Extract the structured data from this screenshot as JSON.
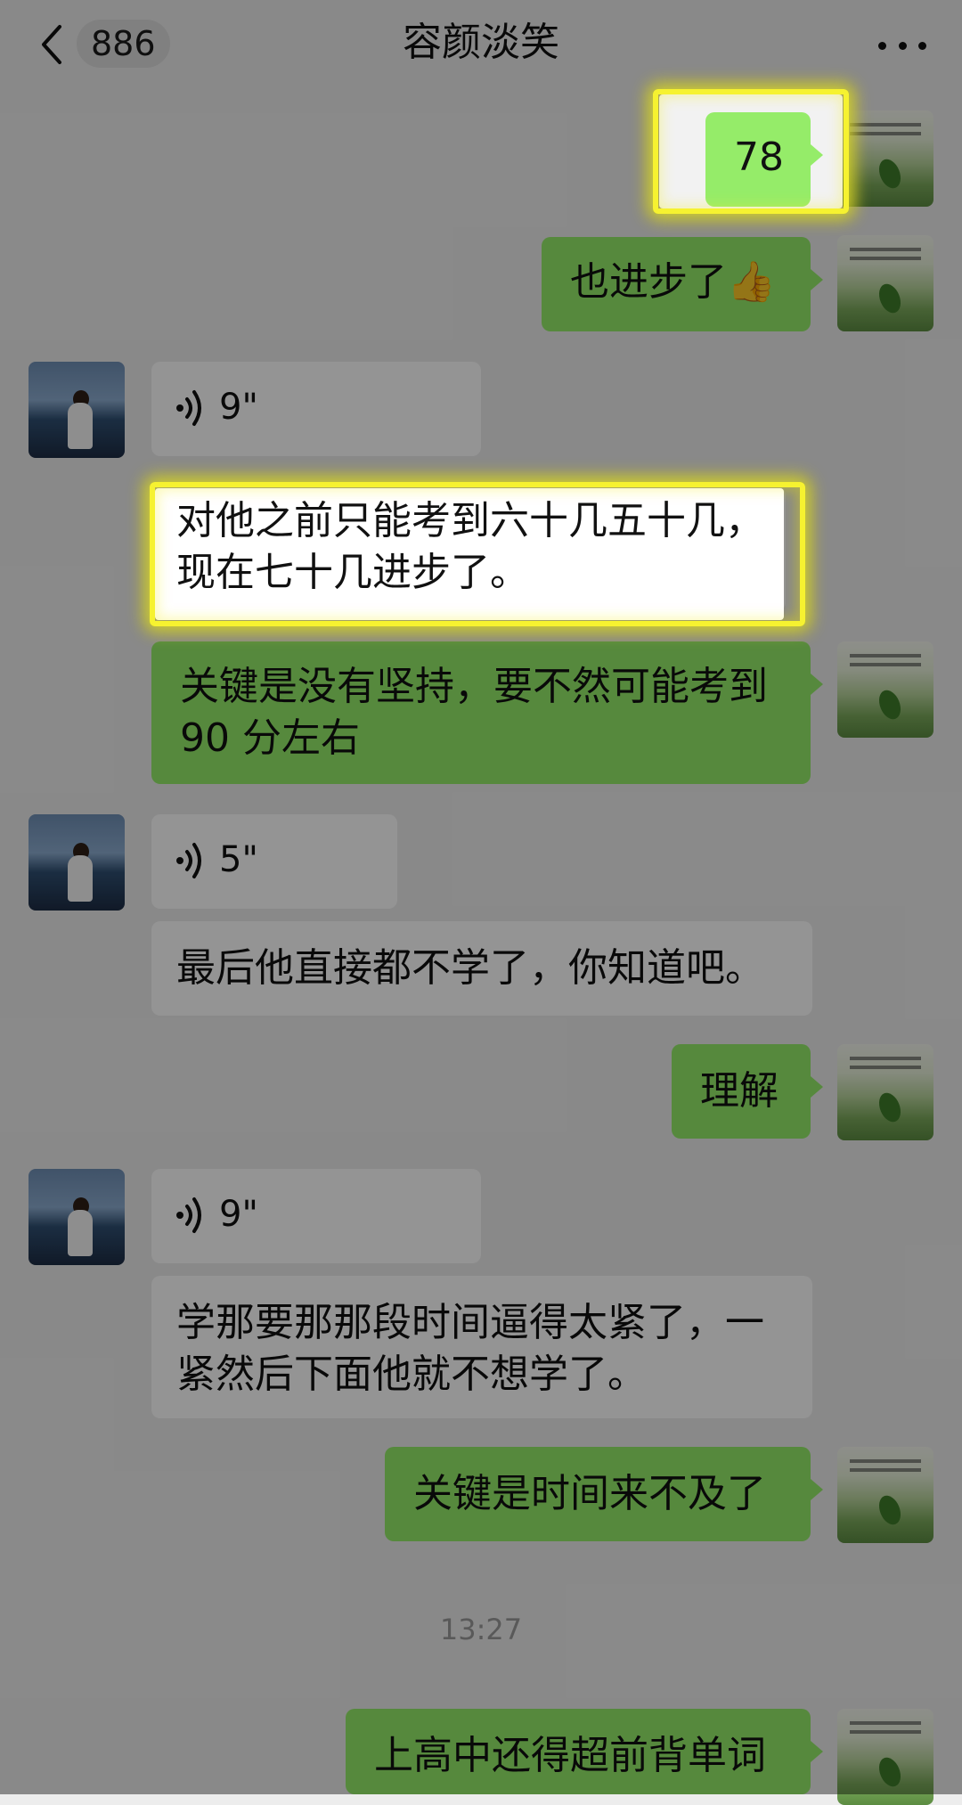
{
  "header": {
    "title": "容颜淡笑",
    "unread_count": "886",
    "back_icon": "chevron-left-icon",
    "more_icon": "more-dots-icon"
  },
  "messages": [
    {
      "from": "me",
      "type": "text",
      "text": "78"
    },
    {
      "from": "me",
      "type": "text",
      "text": "也进步了👍"
    },
    {
      "from": "other",
      "type": "voice",
      "duration": "9\""
    },
    {
      "from": "other",
      "type": "text",
      "text_lines": [
        "对他之前只能考到六十几五十几，",
        "现在七十几进步了。"
      ]
    },
    {
      "from": "me",
      "type": "text",
      "text_lines": [
        "关键是没有坚持，要不然可能考到",
        "90 分左右"
      ]
    },
    {
      "from": "other",
      "type": "voice",
      "duration": "5\""
    },
    {
      "from": "other",
      "type": "text",
      "text": "最后他直接都不学了，你知道吧。"
    },
    {
      "from": "me",
      "type": "text",
      "text": "理解"
    },
    {
      "from": "other",
      "type": "voice",
      "duration": "9\""
    },
    {
      "from": "other",
      "type": "text",
      "text_lines": [
        "学那要那那段时间逼得太紧了，一",
        "紧然后下面他就不想学了。"
      ]
    },
    {
      "from": "me",
      "type": "text",
      "text": "关键是时间来不及了"
    },
    {
      "from": "me",
      "type": "text",
      "text": "上高中还得超前背单词"
    }
  ],
  "timestamp": "13:27",
  "colors": {
    "background": "#ededed",
    "my_bubble": "#95ec69",
    "other_bubble": "#ffffff",
    "highlight": "#f6f230"
  }
}
